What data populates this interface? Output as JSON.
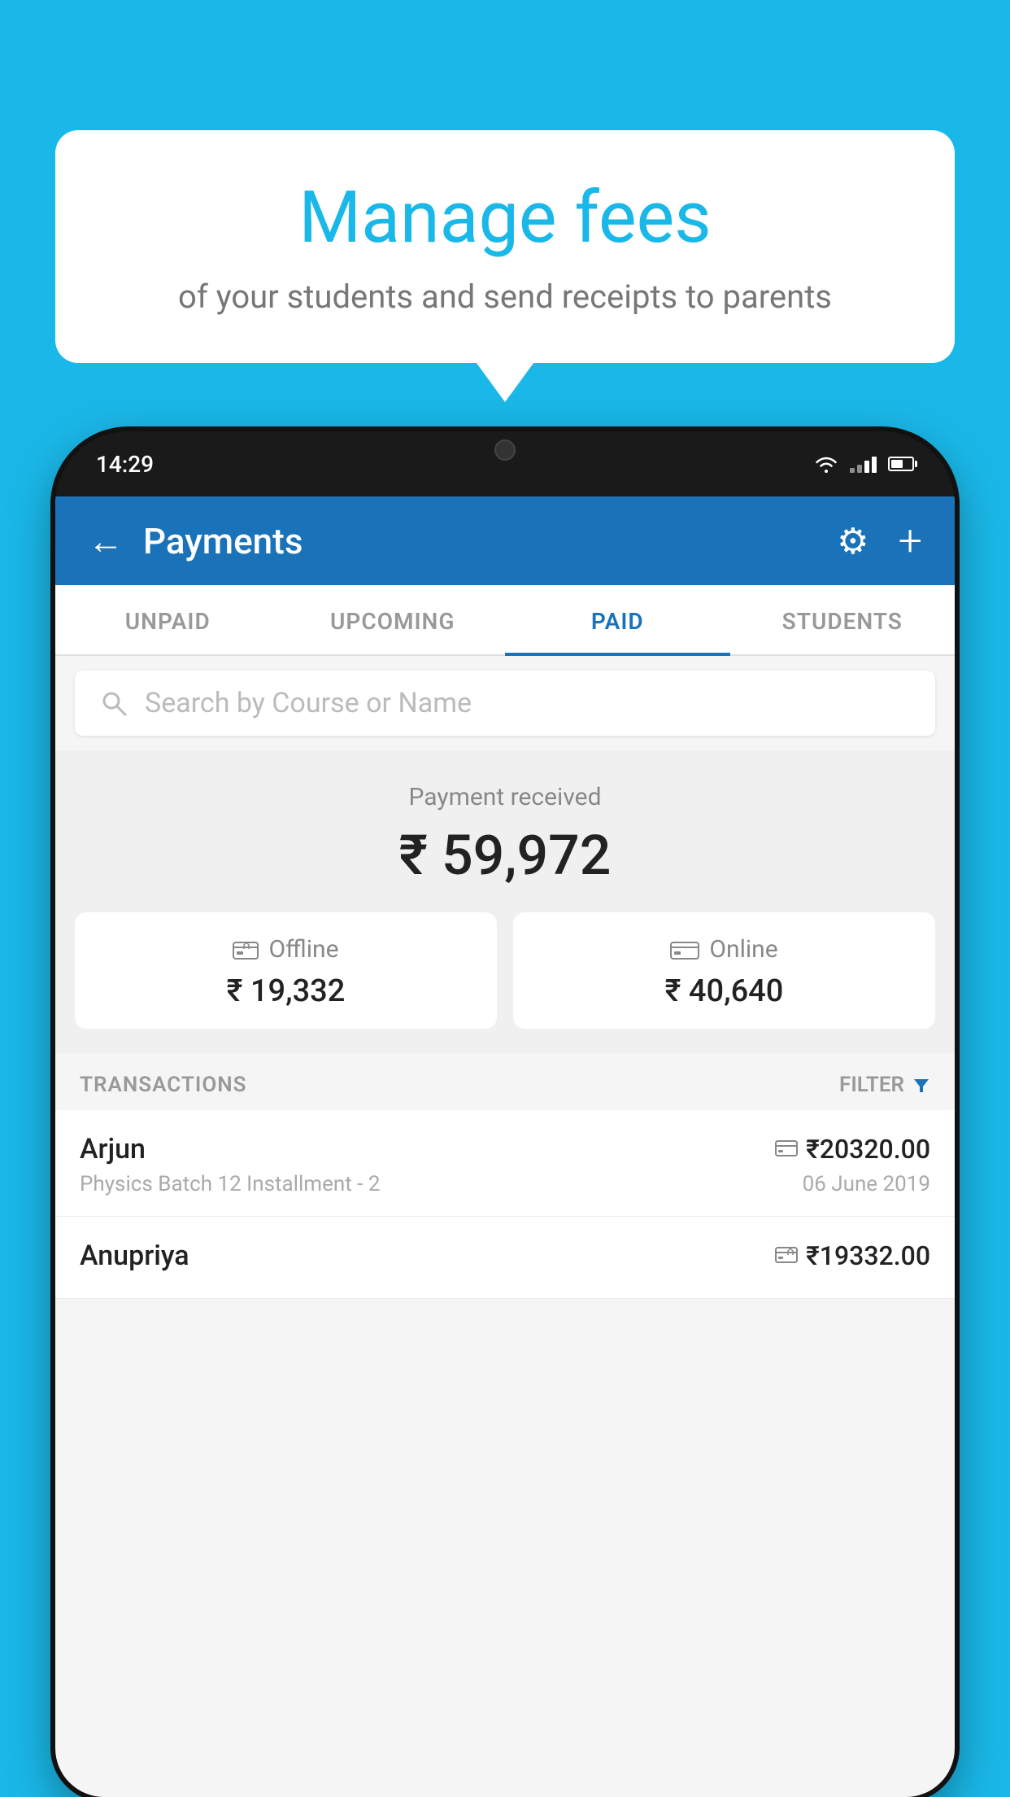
{
  "background_color": "#1ab8e8",
  "speech_bubble": {
    "title": "Manage fees",
    "subtitle": "of your students and send receipts to parents"
  },
  "phone": {
    "status_bar": {
      "time": "14:29",
      "wifi": "▲",
      "signal": true,
      "battery": true
    },
    "header": {
      "back_label": "←",
      "title": "Payments",
      "gear_label": "⚙",
      "plus_label": "+"
    },
    "tabs": [
      {
        "label": "UNPAID",
        "active": false
      },
      {
        "label": "UPCOMING",
        "active": false
      },
      {
        "label": "PAID",
        "active": true
      },
      {
        "label": "STUDENTS",
        "active": false
      }
    ],
    "search": {
      "placeholder": "Search by Course or Name"
    },
    "payment_summary": {
      "label": "Payment received",
      "amount": "₹ 59,972",
      "offline": {
        "label": "Offline",
        "amount": "₹ 19,332"
      },
      "online": {
        "label": "Online",
        "amount": "₹ 40,640"
      }
    },
    "transactions": {
      "label": "TRANSACTIONS",
      "filter_label": "FILTER",
      "rows": [
        {
          "name": "Arjun",
          "detail": "Physics Batch 12 Installment - 2",
          "amount": "₹20320.00",
          "date": "06 June 2019",
          "type": "online"
        },
        {
          "name": "Anupriya",
          "detail": "",
          "amount": "₹19332.00",
          "date": "",
          "type": "offline"
        }
      ]
    }
  }
}
